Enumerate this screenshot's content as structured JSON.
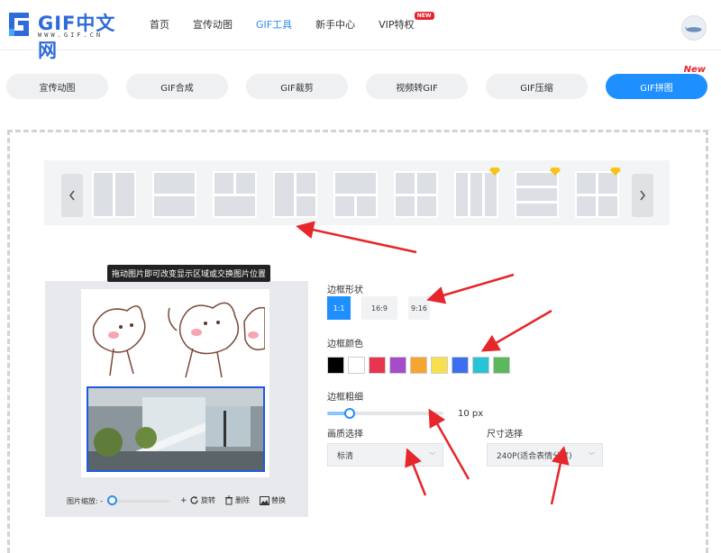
{
  "header": {
    "logo_text": "GIF中文网",
    "logo_sub": "WWW.GIF.CN",
    "nav": [
      {
        "label": "首页",
        "active": false
      },
      {
        "label": "宣传动图",
        "active": false
      },
      {
        "label": "GIF工具",
        "active": true
      },
      {
        "label": "新手中心",
        "active": false
      },
      {
        "label": "VIP特权",
        "active": false,
        "badge": "NEW"
      }
    ]
  },
  "tabs": [
    {
      "label": "宣传动图",
      "active": false
    },
    {
      "label": "GIF合成",
      "active": false
    },
    {
      "label": "GIF裁剪",
      "active": false
    },
    {
      "label": "视频转GIF",
      "active": false
    },
    {
      "label": "GIF压缩",
      "active": false
    },
    {
      "label": "GIF拼图",
      "active": true,
      "badge": "New"
    }
  ],
  "layout_bar": {
    "prev_icon": "chevron-left-icon",
    "next_icon": "chevron-right-icon",
    "layouts": [
      {
        "type": "two-columns",
        "vip": false
      },
      {
        "type": "two-rows",
        "vip": false
      },
      {
        "type": "top-two-bottom-one",
        "vip": false
      },
      {
        "type": "left-one-right-two",
        "vip": false
      },
      {
        "type": "top-one-bottom-two",
        "vip": false
      },
      {
        "type": "grid-four",
        "vip": false
      },
      {
        "type": "three-columns",
        "vip": true
      },
      {
        "type": "three-rows",
        "vip": true
      },
      {
        "type": "grid-four-alt",
        "vip": true
      }
    ]
  },
  "preview": {
    "tooltip": "拖动图片即可改变显示区域或交换图片位置",
    "zoom_label": "图片缩放: -",
    "zoom_plus": "+",
    "rotate_label": "旋转",
    "delete_label": "删除",
    "replace_label": "替换"
  },
  "settings": {
    "shape_label": "边框形状",
    "shapes": [
      {
        "label": "1:1",
        "active": true
      },
      {
        "label": "16:9",
        "active": false
      },
      {
        "label": "9:16",
        "active": false
      }
    ],
    "color_label": "边框颜色",
    "colors": [
      "#000000",
      "#ffffff",
      "#e8344e",
      "#a64bc9",
      "#f7a531",
      "#f8e04c",
      "#3c6ff0",
      "#27c3d6",
      "#5cb85c"
    ],
    "thickness_label": "边框粗细",
    "thickness_value": "10 px",
    "thickness_fraction": 0.2,
    "quality_label": "画质选择",
    "quality_value": "标清",
    "size_label": "尺寸选择",
    "size_value": "240P(适合表情分享)"
  }
}
